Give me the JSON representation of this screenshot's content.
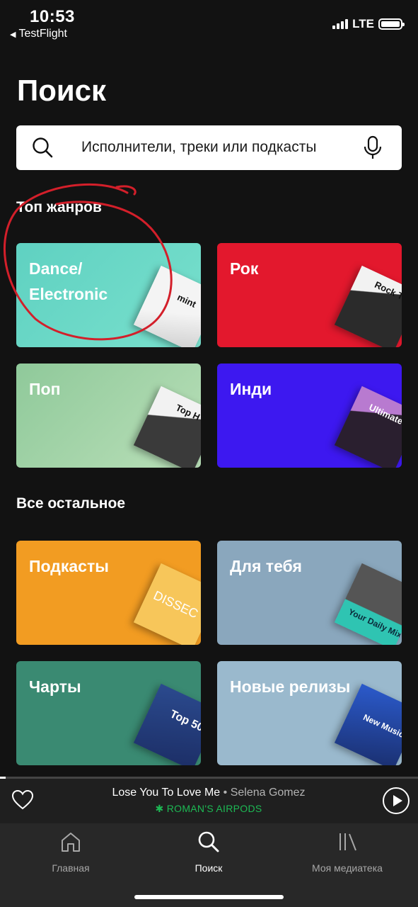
{
  "status_bar": {
    "time": "10:53",
    "back_app": "TestFlight",
    "network": "LTE"
  },
  "page": {
    "title": "Поиск"
  },
  "search": {
    "placeholder": "Исполнители, треки или подкасты"
  },
  "sections": {
    "top_genres": {
      "title": "Топ жанров",
      "tiles": [
        {
          "label": "Dance/ Electronic",
          "color": "#5fd1c1",
          "cover_text": "mint"
        },
        {
          "label": "Рок",
          "color": "#e3182d",
          "cover_text": "Rock T"
        },
        {
          "label": "Поп",
          "color": "#a8d6ad",
          "cover_text": "Top H"
        },
        {
          "label": "Инди",
          "color": "#3d18f0",
          "cover_text": "Ultimate"
        }
      ]
    },
    "everything_else": {
      "title": "Все остальное",
      "tiles": [
        {
          "label": "Подкасты",
          "color": "#f29c22",
          "cover_text": "DISSEC"
        },
        {
          "label": "Для тебя",
          "color": "#8aa7bd",
          "cover_text": "Your Daily Mix"
        },
        {
          "label": "Чарты",
          "color": "#3a8a72",
          "cover_text": "Top 50"
        },
        {
          "label": "Новые релизы",
          "color": "#9ab9cd",
          "cover_text": "New Music"
        }
      ]
    }
  },
  "now_playing": {
    "title": "Lose You To Love Me",
    "separator": " • ",
    "artist": "Selena Gomez",
    "device": "ROMAN'S AIRPODS"
  },
  "tab_bar": {
    "tabs": [
      {
        "label": "Главная",
        "icon": "home-icon"
      },
      {
        "label": "Поиск",
        "icon": "search-icon"
      },
      {
        "label": "Моя медиатека",
        "icon": "library-icon"
      }
    ]
  },
  "colors": {
    "accent": "#1db954",
    "background": "#121212",
    "annotation": "#d31f2a"
  }
}
